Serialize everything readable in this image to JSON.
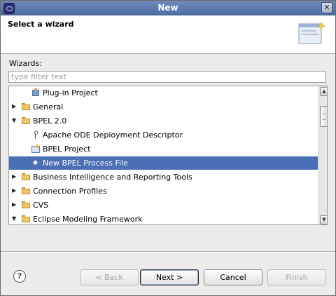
{
  "window": {
    "title": "New"
  },
  "header": {
    "title": "Select a wizard"
  },
  "wizards": {
    "label": "Wizards:",
    "filter_placeholder": "type filter text"
  },
  "tree": {
    "items": [
      {
        "label": "Plug-in Project",
        "icon": "plugin-icon",
        "expander": "none",
        "level": 1,
        "selected": false
      },
      {
        "label": "General",
        "icon": "folder-icon",
        "expander": "collapsed",
        "level": 0,
        "selected": false
      },
      {
        "label": "BPEL 2.0",
        "icon": "folder-icon",
        "expander": "expanded",
        "level": 0,
        "selected": false
      },
      {
        "label": "Apache ODE Deployment Descriptor",
        "icon": "key-icon",
        "expander": "none",
        "level": 1,
        "selected": false
      },
      {
        "label": "BPEL Project",
        "icon": "project-icon",
        "expander": "none",
        "level": 1,
        "selected": false
      },
      {
        "label": "New BPEL Process File",
        "icon": "file-icon",
        "expander": "none",
        "level": 1,
        "selected": true
      },
      {
        "label": "Business Intelligence and Reporting Tools",
        "icon": "folder-icon",
        "expander": "collapsed",
        "level": 0,
        "selected": false
      },
      {
        "label": "Connection Profiles",
        "icon": "folder-icon",
        "expander": "collapsed",
        "level": 0,
        "selected": false
      },
      {
        "label": "CVS",
        "icon": "folder-icon",
        "expander": "collapsed",
        "level": 0,
        "selected": false
      },
      {
        "label": "Eclipse Modeling Framework",
        "icon": "folder-icon",
        "expander": "expanded",
        "level": 0,
        "selected": false
      }
    ]
  },
  "buttons": {
    "help": "?",
    "back": "< Back",
    "next": "Next >",
    "cancel": "Cancel",
    "finish": "Finish"
  },
  "colors": {
    "selection": "#4a6fb5",
    "title_bar": "#5a78ae"
  }
}
